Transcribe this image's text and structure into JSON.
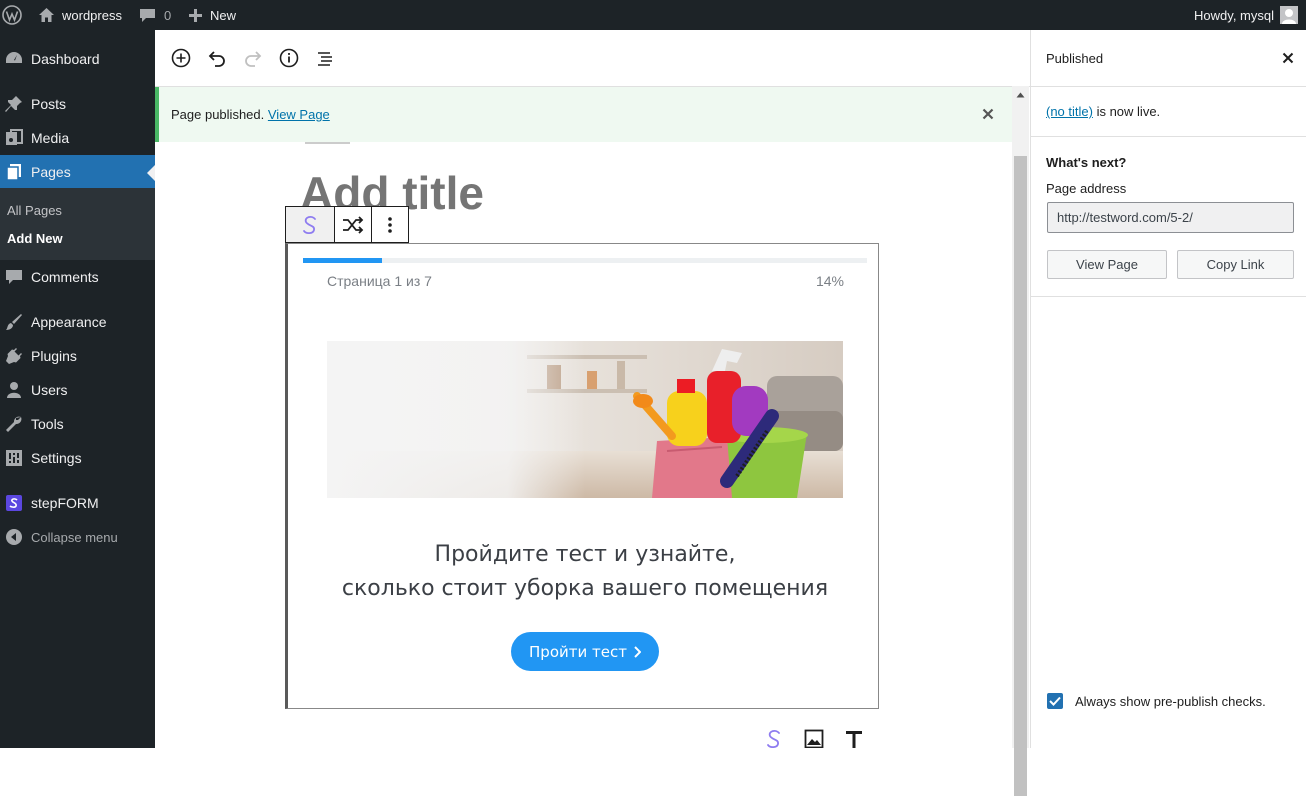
{
  "admin_bar": {
    "site_name": "wordpress",
    "comments_count": "0",
    "new_label": "New",
    "greeting": "Howdy, mysql"
  },
  "sidebar": {
    "items": [
      {
        "label": "Dashboard",
        "icon": "dashboard-icon"
      },
      {
        "label": "Posts",
        "icon": "pin-icon"
      },
      {
        "label": "Media",
        "icon": "media-icon"
      },
      {
        "label": "Pages",
        "icon": "pages-icon",
        "current": true
      },
      {
        "label": "Comments",
        "icon": "comment-icon"
      },
      {
        "label": "Appearance",
        "icon": "brush-icon"
      },
      {
        "label": "Plugins",
        "icon": "plug-icon"
      },
      {
        "label": "Users",
        "icon": "user-icon"
      },
      {
        "label": "Tools",
        "icon": "wrench-icon"
      },
      {
        "label": "Settings",
        "icon": "settings-icon"
      },
      {
        "label": "stepFORM",
        "icon": "stepform-icon"
      },
      {
        "label": "Collapse menu",
        "icon": "collapse-icon"
      }
    ],
    "submenu": [
      {
        "label": "All Pages"
      },
      {
        "label": "Add New",
        "current": true
      }
    ]
  },
  "notice": {
    "text": "Page published.",
    "link": "View Page"
  },
  "editor": {
    "title_placeholder": "Add title"
  },
  "stepform": {
    "progress_label": "Страница 1 из 7",
    "progress_percent": "14%",
    "progress_value": 0.14,
    "headline_line1": "Пройдите тест и узнайте,",
    "headline_line2": "сколько стоит уборка вашего помещения",
    "button_label": "Пройти тест",
    "accent_color": "#2196f3"
  },
  "panel": {
    "title": "Published",
    "live_link": "(no title)",
    "live_suffix": " is now live.",
    "whats_next": "What's next?",
    "address_label": "Page address",
    "address_value": "http://testword.com/5-2/",
    "view_button": "View Page",
    "copy_button": "Copy Link",
    "prepublish_label": "Always show pre-publish checks.",
    "prepublish_checked": true
  },
  "colors": {
    "admin_dark": "#1d2327",
    "wp_blue": "#2271b1",
    "notice_green": "#4ab866"
  }
}
